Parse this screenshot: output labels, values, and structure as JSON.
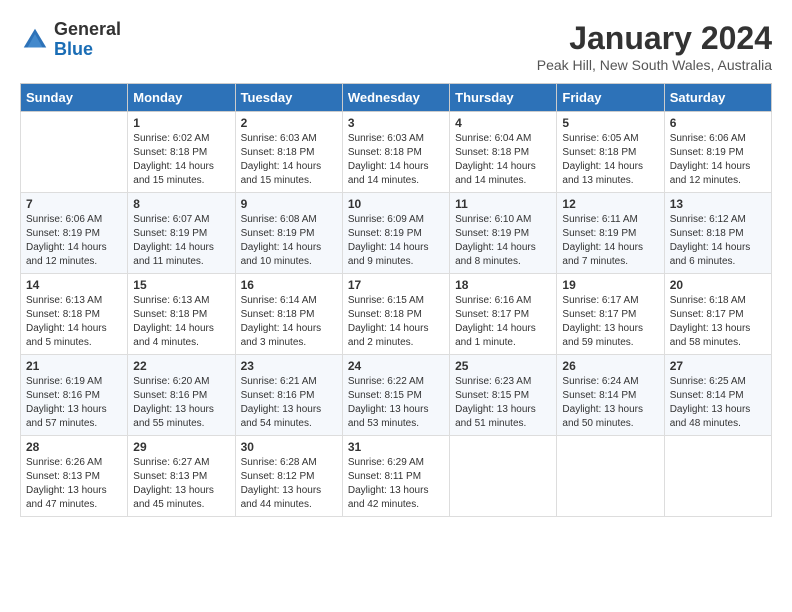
{
  "header": {
    "logo_general": "General",
    "logo_blue": "Blue",
    "month_title": "January 2024",
    "location": "Peak Hill, New South Wales, Australia"
  },
  "weekdays": [
    "Sunday",
    "Monday",
    "Tuesday",
    "Wednesday",
    "Thursday",
    "Friday",
    "Saturday"
  ],
  "weeks": [
    [
      {
        "day": "",
        "info": ""
      },
      {
        "day": "1",
        "info": "Sunrise: 6:02 AM\nSunset: 8:18 PM\nDaylight: 14 hours\nand 15 minutes."
      },
      {
        "day": "2",
        "info": "Sunrise: 6:03 AM\nSunset: 8:18 PM\nDaylight: 14 hours\nand 15 minutes."
      },
      {
        "day": "3",
        "info": "Sunrise: 6:03 AM\nSunset: 8:18 PM\nDaylight: 14 hours\nand 14 minutes."
      },
      {
        "day": "4",
        "info": "Sunrise: 6:04 AM\nSunset: 8:18 PM\nDaylight: 14 hours\nand 14 minutes."
      },
      {
        "day": "5",
        "info": "Sunrise: 6:05 AM\nSunset: 8:18 PM\nDaylight: 14 hours\nand 13 minutes."
      },
      {
        "day": "6",
        "info": "Sunrise: 6:06 AM\nSunset: 8:19 PM\nDaylight: 14 hours\nand 12 minutes."
      }
    ],
    [
      {
        "day": "7",
        "info": "Sunrise: 6:06 AM\nSunset: 8:19 PM\nDaylight: 14 hours\nand 12 minutes."
      },
      {
        "day": "8",
        "info": "Sunrise: 6:07 AM\nSunset: 8:19 PM\nDaylight: 14 hours\nand 11 minutes."
      },
      {
        "day": "9",
        "info": "Sunrise: 6:08 AM\nSunset: 8:19 PM\nDaylight: 14 hours\nand 10 minutes."
      },
      {
        "day": "10",
        "info": "Sunrise: 6:09 AM\nSunset: 8:19 PM\nDaylight: 14 hours\nand 9 minutes."
      },
      {
        "day": "11",
        "info": "Sunrise: 6:10 AM\nSunset: 8:19 PM\nDaylight: 14 hours\nand 8 minutes."
      },
      {
        "day": "12",
        "info": "Sunrise: 6:11 AM\nSunset: 8:19 PM\nDaylight: 14 hours\nand 7 minutes."
      },
      {
        "day": "13",
        "info": "Sunrise: 6:12 AM\nSunset: 8:18 PM\nDaylight: 14 hours\nand 6 minutes."
      }
    ],
    [
      {
        "day": "14",
        "info": "Sunrise: 6:13 AM\nSunset: 8:18 PM\nDaylight: 14 hours\nand 5 minutes."
      },
      {
        "day": "15",
        "info": "Sunrise: 6:13 AM\nSunset: 8:18 PM\nDaylight: 14 hours\nand 4 minutes."
      },
      {
        "day": "16",
        "info": "Sunrise: 6:14 AM\nSunset: 8:18 PM\nDaylight: 14 hours\nand 3 minutes."
      },
      {
        "day": "17",
        "info": "Sunrise: 6:15 AM\nSunset: 8:18 PM\nDaylight: 14 hours\nand 2 minutes."
      },
      {
        "day": "18",
        "info": "Sunrise: 6:16 AM\nSunset: 8:17 PM\nDaylight: 14 hours\nand 1 minute."
      },
      {
        "day": "19",
        "info": "Sunrise: 6:17 AM\nSunset: 8:17 PM\nDaylight: 13 hours\nand 59 minutes."
      },
      {
        "day": "20",
        "info": "Sunrise: 6:18 AM\nSunset: 8:17 PM\nDaylight: 13 hours\nand 58 minutes."
      }
    ],
    [
      {
        "day": "21",
        "info": "Sunrise: 6:19 AM\nSunset: 8:16 PM\nDaylight: 13 hours\nand 57 minutes."
      },
      {
        "day": "22",
        "info": "Sunrise: 6:20 AM\nSunset: 8:16 PM\nDaylight: 13 hours\nand 55 minutes."
      },
      {
        "day": "23",
        "info": "Sunrise: 6:21 AM\nSunset: 8:16 PM\nDaylight: 13 hours\nand 54 minutes."
      },
      {
        "day": "24",
        "info": "Sunrise: 6:22 AM\nSunset: 8:15 PM\nDaylight: 13 hours\nand 53 minutes."
      },
      {
        "day": "25",
        "info": "Sunrise: 6:23 AM\nSunset: 8:15 PM\nDaylight: 13 hours\nand 51 minutes."
      },
      {
        "day": "26",
        "info": "Sunrise: 6:24 AM\nSunset: 8:14 PM\nDaylight: 13 hours\nand 50 minutes."
      },
      {
        "day": "27",
        "info": "Sunrise: 6:25 AM\nSunset: 8:14 PM\nDaylight: 13 hours\nand 48 minutes."
      }
    ],
    [
      {
        "day": "28",
        "info": "Sunrise: 6:26 AM\nSunset: 8:13 PM\nDaylight: 13 hours\nand 47 minutes."
      },
      {
        "day": "29",
        "info": "Sunrise: 6:27 AM\nSunset: 8:13 PM\nDaylight: 13 hours\nand 45 minutes."
      },
      {
        "day": "30",
        "info": "Sunrise: 6:28 AM\nSunset: 8:12 PM\nDaylight: 13 hours\nand 44 minutes."
      },
      {
        "day": "31",
        "info": "Sunrise: 6:29 AM\nSunset: 8:11 PM\nDaylight: 13 hours\nand 42 minutes."
      },
      {
        "day": "",
        "info": ""
      },
      {
        "day": "",
        "info": ""
      },
      {
        "day": "",
        "info": ""
      }
    ]
  ]
}
